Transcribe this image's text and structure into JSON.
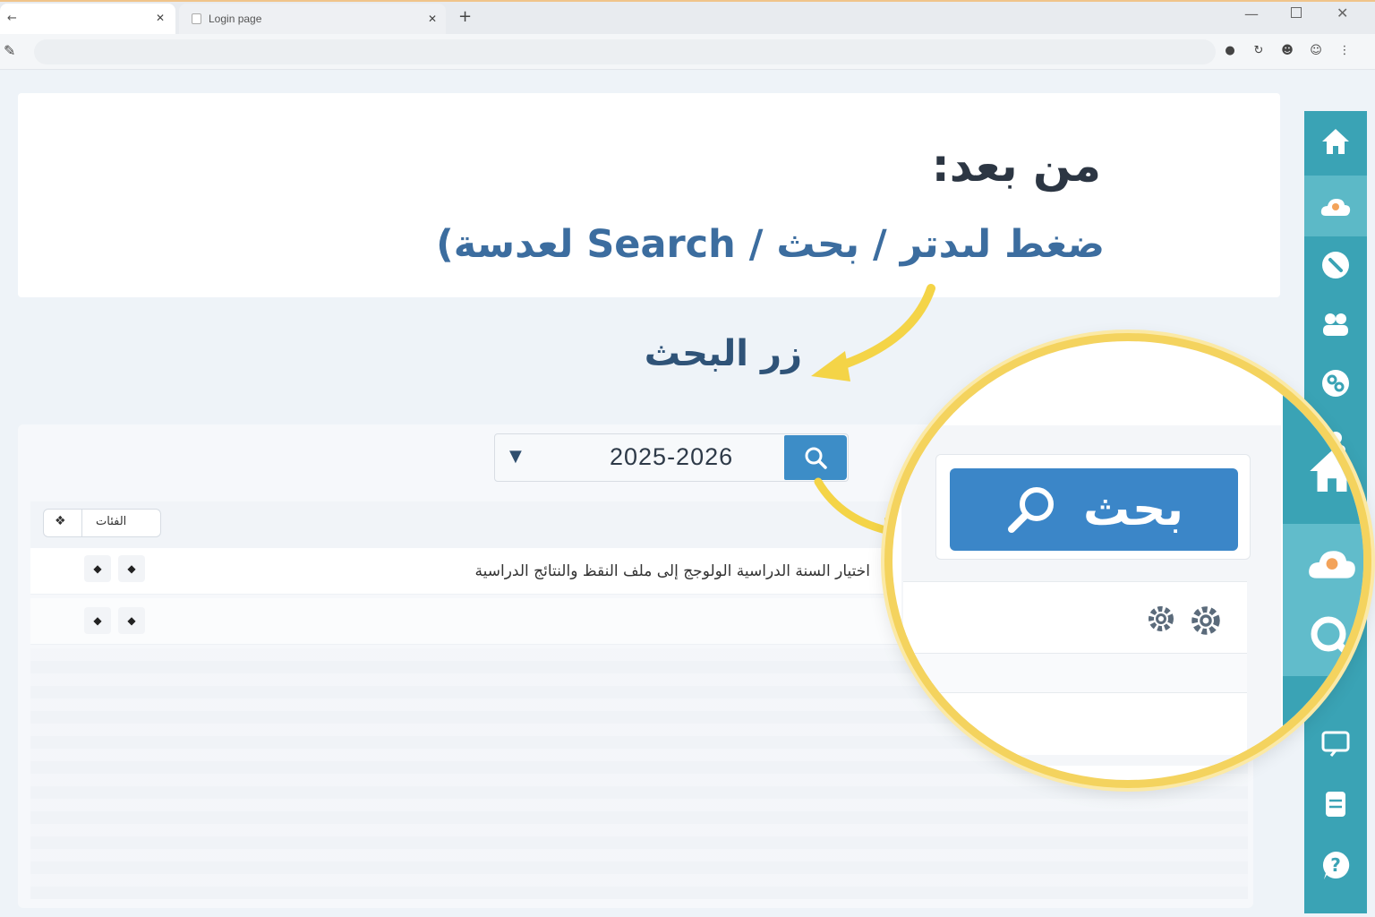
{
  "browser": {
    "tabs": [
      {
        "title": ""
      },
      {
        "title": "Login page"
      }
    ],
    "new_tab": "+"
  },
  "instruction": {
    "title": "من بعد:",
    "subtitle": "ضغط لىدتر / بحث / Search لعدسة)",
    "button_caption": "زر البحث"
  },
  "search": {
    "year_value": "2025-2026",
    "button_label": "بحث"
  },
  "table": {
    "header_label": "الفئات",
    "rows": [
      {
        "text": "اختيار السنة الدراسية الولوجج إلى ملف النقظ والنتائج الدراسية"
      },
      {
        "text": ""
      }
    ]
  },
  "sidebar": {
    "items": [
      {
        "icon": "home-icon"
      },
      {
        "icon": "user-cloud-icon"
      },
      {
        "icon": "link-icon"
      },
      {
        "icon": "users-icon"
      },
      {
        "icon": "chain-icon"
      },
      {
        "icon": "group-icon"
      },
      {
        "icon": "search-icon"
      },
      {
        "icon": "group-icon"
      },
      {
        "icon": "board-icon"
      },
      {
        "icon": "server-icon"
      },
      {
        "icon": "help-icon"
      }
    ]
  },
  "colors": {
    "accent": "#3b86c8",
    "sidebar": "#3aa3b5",
    "highlight": "#f4d35e"
  }
}
